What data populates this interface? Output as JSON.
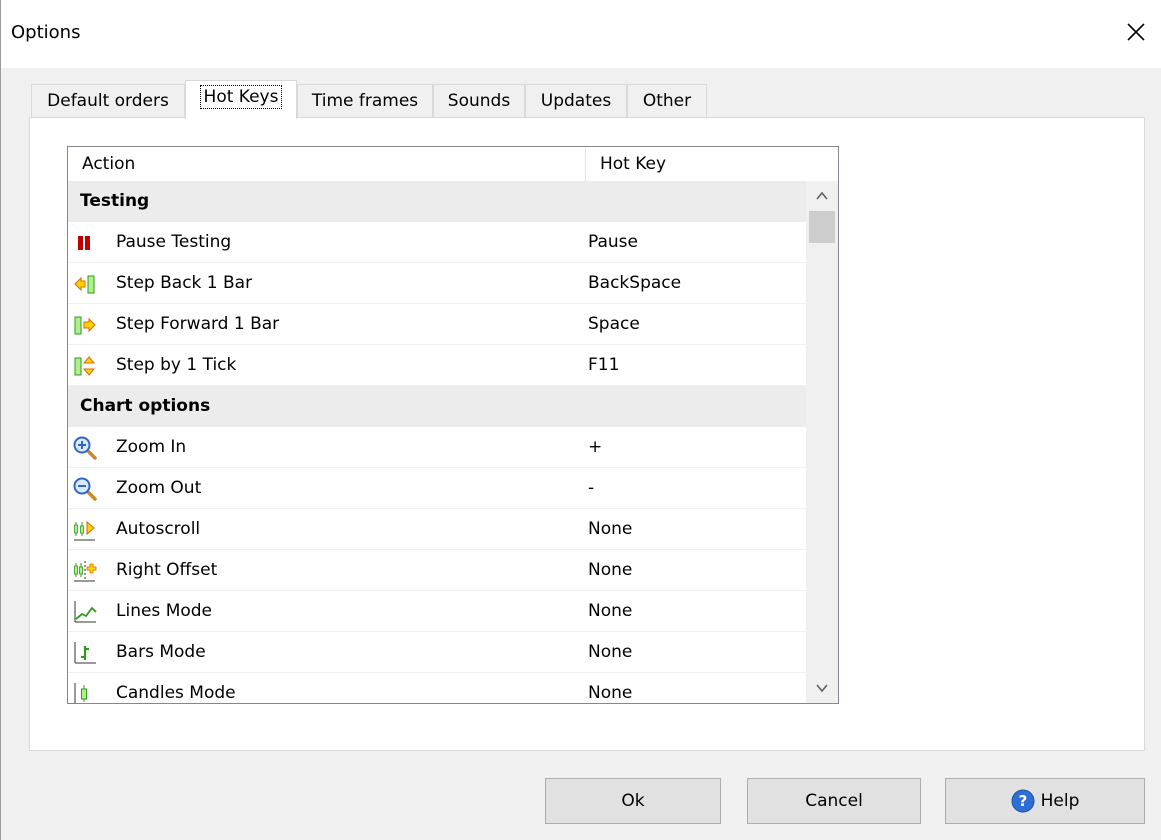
{
  "window": {
    "title": "Options"
  },
  "tabs": [
    {
      "label": "Default orders",
      "active": false
    },
    {
      "label": "Hot Keys",
      "active": true
    },
    {
      "label": "Time frames",
      "active": false
    },
    {
      "label": "Sounds",
      "active": false
    },
    {
      "label": "Updates",
      "active": false
    },
    {
      "label": "Other",
      "active": false
    }
  ],
  "table": {
    "columns": [
      "Action",
      "Hot Key"
    ],
    "rows": [
      {
        "type": "group",
        "label": "Testing"
      },
      {
        "type": "item",
        "icon": "pause-icon",
        "label": "Pause Testing",
        "key": "Pause"
      },
      {
        "type": "item",
        "icon": "step-back-icon",
        "label": "Step Back 1 Bar",
        "key": "BackSpace"
      },
      {
        "type": "item",
        "icon": "step-forward-icon",
        "label": "Step Forward 1 Bar",
        "key": "Space"
      },
      {
        "type": "item",
        "icon": "step-tick-icon",
        "label": "Step by 1 Tick",
        "key": "F11"
      },
      {
        "type": "group",
        "label": "Chart options"
      },
      {
        "type": "item",
        "icon": "zoom-in-icon",
        "label": "Zoom In",
        "key": "+"
      },
      {
        "type": "item",
        "icon": "zoom-out-icon",
        "label": "Zoom Out",
        "key": "-"
      },
      {
        "type": "item",
        "icon": "autoscroll-icon",
        "label": "Autoscroll",
        "key": "None"
      },
      {
        "type": "item",
        "icon": "right-offset-icon",
        "label": "Right Offset",
        "key": "None"
      },
      {
        "type": "item",
        "icon": "lines-mode-icon",
        "label": "Lines Mode",
        "key": "None"
      },
      {
        "type": "item",
        "icon": "bars-mode-icon",
        "label": "Bars Mode",
        "key": "None"
      },
      {
        "type": "item",
        "icon": "candles-mode-icon",
        "label": "Candles Mode",
        "key": "None"
      }
    ]
  },
  "buttons": {
    "ok": "Ok",
    "cancel": "Cancel",
    "help": "Help"
  }
}
